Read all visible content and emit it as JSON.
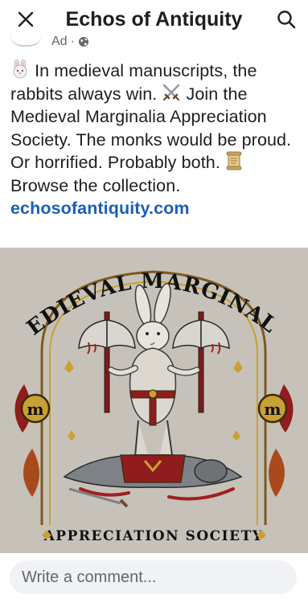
{
  "header": {
    "title": "Echos of Antiquity",
    "close_icon": "close-icon",
    "search_icon": "search-icon"
  },
  "post_meta": {
    "sponsored_label": "Ad",
    "separator": "·",
    "audience_icon": "globe-icon"
  },
  "post": {
    "line_1": "In medieval manuscripts, the rabbits always win.",
    "line_1_emoji": "rabbit-face",
    "line_2": "Join the Medieval Marginalia Appreciation Society. The monks would be proud. Or horrified. Probably both.",
    "line_2_emoji": "crossed-swords",
    "line_2_end_emoji": "scroll",
    "line_3": "Browse the collection.",
    "link_text": "echosofantiquity.com"
  },
  "image": {
    "title_text": "MEDIEVAL MARGINALIA",
    "subtitle_text": "APPRECIATION SOCIETY",
    "medallion_letter": "m",
    "background_color": "#c7c2b9",
    "accent_red": "#8f1d1d",
    "accent_gold": "#c9a032"
  },
  "comment": {
    "placeholder": "Write a comment..."
  }
}
